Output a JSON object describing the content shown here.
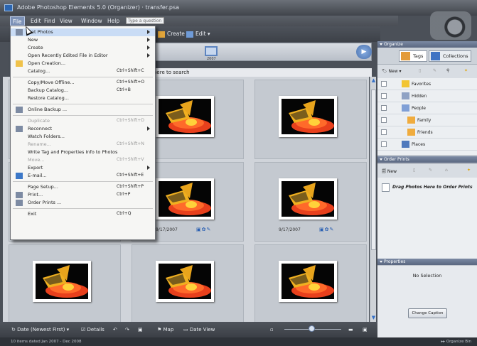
{
  "window": {
    "title": "Adobe Photoshop Elements 5.0 (Organizer) · transfer.psa"
  },
  "menubar": {
    "items": [
      "File",
      "Edit",
      "Find",
      "View",
      "Window",
      "Help"
    ],
    "help_placeholder": "Type a question for help"
  },
  "toolbar": {
    "create": "Create ▾",
    "edit": "Edit ▾"
  },
  "timeline": {
    "year_label": "2007",
    "play_symbol": "▶"
  },
  "browser": {
    "search_hint": "here to search"
  },
  "photos": [
    {
      "date": "",
      "badges": ""
    },
    {
      "date": "",
      "badges": ""
    },
    {
      "date": "",
      "badges": ""
    },
    {
      "date": "",
      "badges": ""
    },
    {
      "date": "9/17/2007",
      "badges": "▣✿✎"
    },
    {
      "date": "9/17/2007",
      "badges": "▣✿✎"
    },
    {
      "date": "",
      "badges": ""
    },
    {
      "date": "",
      "badges": ""
    },
    {
      "date": "",
      "badges": ""
    },
    {
      "date": "1/17/2007",
      "badges": "▣✿✎"
    },
    {
      "date": "9/17/2007",
      "badges": "▣▤✿✎"
    },
    {
      "date": "",
      "badges": ""
    }
  ],
  "bottombar": {
    "sort": "Date (Newest First)",
    "details": "Details",
    "map": "Map",
    "date_view": "Date View"
  },
  "status": {
    "left": "10 items dated Jan 2007 - Dec 2008",
    "right": "▸▸ Organize Bin"
  },
  "organize": {
    "header": "Organize",
    "tab_tags": "Tags",
    "tab_collections": "Collections",
    "new_label": "New ▾",
    "tags": [
      {
        "label": "Favorites",
        "indent": 1
      },
      {
        "label": "Hidden",
        "indent": 1
      },
      {
        "label": "People",
        "indent": 1
      },
      {
        "label": "Family",
        "indent": 2
      },
      {
        "label": "Friends",
        "indent": 2
      },
      {
        "label": "Places",
        "indent": 1
      }
    ]
  },
  "order_prints": {
    "header": "Order Prints",
    "new_label": "New",
    "drag_text": "Drag Photos Here to Order Prints"
  },
  "properties": {
    "header": "Properties",
    "no_selection": "No Selection",
    "change_caption": "Change Caption"
  },
  "file_menu": {
    "items": [
      {
        "label": "Get Photos",
        "shortcut": "",
        "submenu": true,
        "disabled": false,
        "highlight": true,
        "icon": "camera-icon"
      },
      {
        "label": "New",
        "shortcut": "",
        "submenu": true,
        "disabled": false
      },
      {
        "label": "Create",
        "shortcut": "",
        "submenu": true,
        "disabled": false
      },
      {
        "label": "Open Recently Edited File in Editor",
        "shortcut": "",
        "submenu": true,
        "disabled": false
      },
      {
        "label": "Open Creation...",
        "shortcut": "",
        "submenu": false,
        "disabled": false,
        "icon": "folder-icon"
      },
      {
        "label": "Catalog...",
        "shortcut": "Ctrl+Shift+C",
        "submenu": false,
        "disabled": false
      },
      {
        "sep": true
      },
      {
        "label": "Copy/Move Offline...",
        "shortcut": "Ctrl+Shift+O",
        "submenu": false,
        "disabled": false
      },
      {
        "label": "Backup Catalog...",
        "shortcut": "Ctrl+B",
        "submenu": false,
        "disabled": false
      },
      {
        "label": "Restore Catalog...",
        "shortcut": "",
        "submenu": false,
        "disabled": false
      },
      {
        "sep": true
      },
      {
        "label": "Online Backup ...",
        "shortcut": "",
        "submenu": false,
        "disabled": false,
        "icon": "globe-icon"
      },
      {
        "sep": true
      },
      {
        "label": "Duplicate",
        "shortcut": "Ctrl+Shift+D",
        "submenu": false,
        "disabled": true
      },
      {
        "label": "Reconnect",
        "shortcut": "",
        "submenu": true,
        "disabled": false,
        "icon": "reconnect-icon"
      },
      {
        "label": "Watch Folders...",
        "shortcut": "",
        "submenu": false,
        "disabled": false
      },
      {
        "label": "Rename...",
        "shortcut": "Ctrl+Shift+N",
        "submenu": false,
        "disabled": true
      },
      {
        "label": "Write Tag and Properties Info to Photos",
        "shortcut": "",
        "submenu": false,
        "disabled": false
      },
      {
        "label": "Move...",
        "shortcut": "Ctrl+Shift+V",
        "submenu": false,
        "disabled": true
      },
      {
        "label": "Export",
        "shortcut": "",
        "submenu": true,
        "disabled": false
      },
      {
        "label": "E-mail...",
        "shortcut": "Ctrl+Shift+E",
        "submenu": false,
        "disabled": false,
        "icon": "email-icon"
      },
      {
        "sep": true
      },
      {
        "label": "Page Setup...",
        "shortcut": "Ctrl+Shift+P",
        "submenu": false,
        "disabled": false
      },
      {
        "label": "Print...",
        "shortcut": "Ctrl+P",
        "submenu": false,
        "disabled": false,
        "icon": "printer-icon"
      },
      {
        "label": "Order Prints ...",
        "shortcut": "",
        "submenu": false,
        "disabled": false,
        "icon": "order-prints-icon"
      },
      {
        "sep": true
      },
      {
        "label": "Exit",
        "shortcut": "Ctrl+Q",
        "submenu": false,
        "disabled": false
      }
    ]
  },
  "colors": {
    "accent": "#7d92b7",
    "panel_header": "#5a6780",
    "menu_highlight": "#c9dcf5"
  }
}
